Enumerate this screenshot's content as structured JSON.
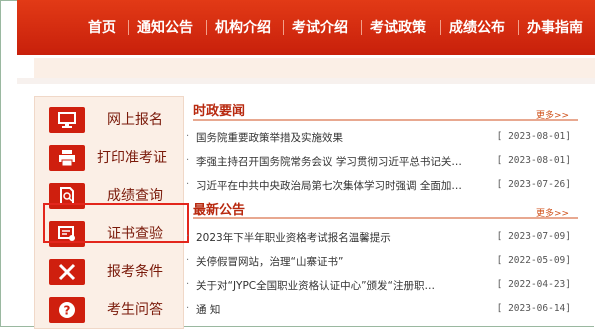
{
  "nav": {
    "items": [
      "首页",
      "通知公告",
      "机构介绍",
      "考试介绍",
      "考试政策",
      "成绩公布",
      "办事指南"
    ]
  },
  "sidebar": {
    "items": [
      {
        "label": "网上报名",
        "icon": "monitor-icon"
      },
      {
        "label": "打印准考证",
        "icon": "printer-icon"
      },
      {
        "label": "成绩查询",
        "icon": "search-document-icon"
      },
      {
        "label": "证书查验",
        "icon": "certificate-verify-icon"
      },
      {
        "label": "报考条件",
        "icon": "tools-icon"
      },
      {
        "label": "考生问答",
        "icon": "question-icon"
      }
    ]
  },
  "news": {
    "title": "时政要闻",
    "more": "更多>>",
    "items": [
      {
        "title": "国务院重要政策举措及实施效果",
        "date": "[ 2023-08-01]"
      },
      {
        "title": "李强主持召开国务院常务会议 学习贯彻习近平总书记关…",
        "date": "[ 2023-08-01]"
      },
      {
        "title": "习近平在中共中央政治局第七次集体学习时强调 全面加…",
        "date": "[ 2023-07-26]"
      }
    ]
  },
  "notices": {
    "title": "最新公告",
    "more": "更多>>",
    "items": [
      {
        "title": "2023年下半年职业资格考试报名温馨提示",
        "date": "[ 2023-07-09]"
      },
      {
        "title": "关停假冒网站，治理“山寨证书”",
        "date": "[ 2022-05-09]"
      },
      {
        "title": "关于对“JYPC全国职业资格认证中心”颁发“注册职…",
        "date": "[ 2022-04-23]"
      },
      {
        "title": "通 知",
        "date": "[ 2023-06-14]"
      }
    ]
  },
  "colors": {
    "brand_red": "#c8200b",
    "accent": "#e3261c"
  }
}
